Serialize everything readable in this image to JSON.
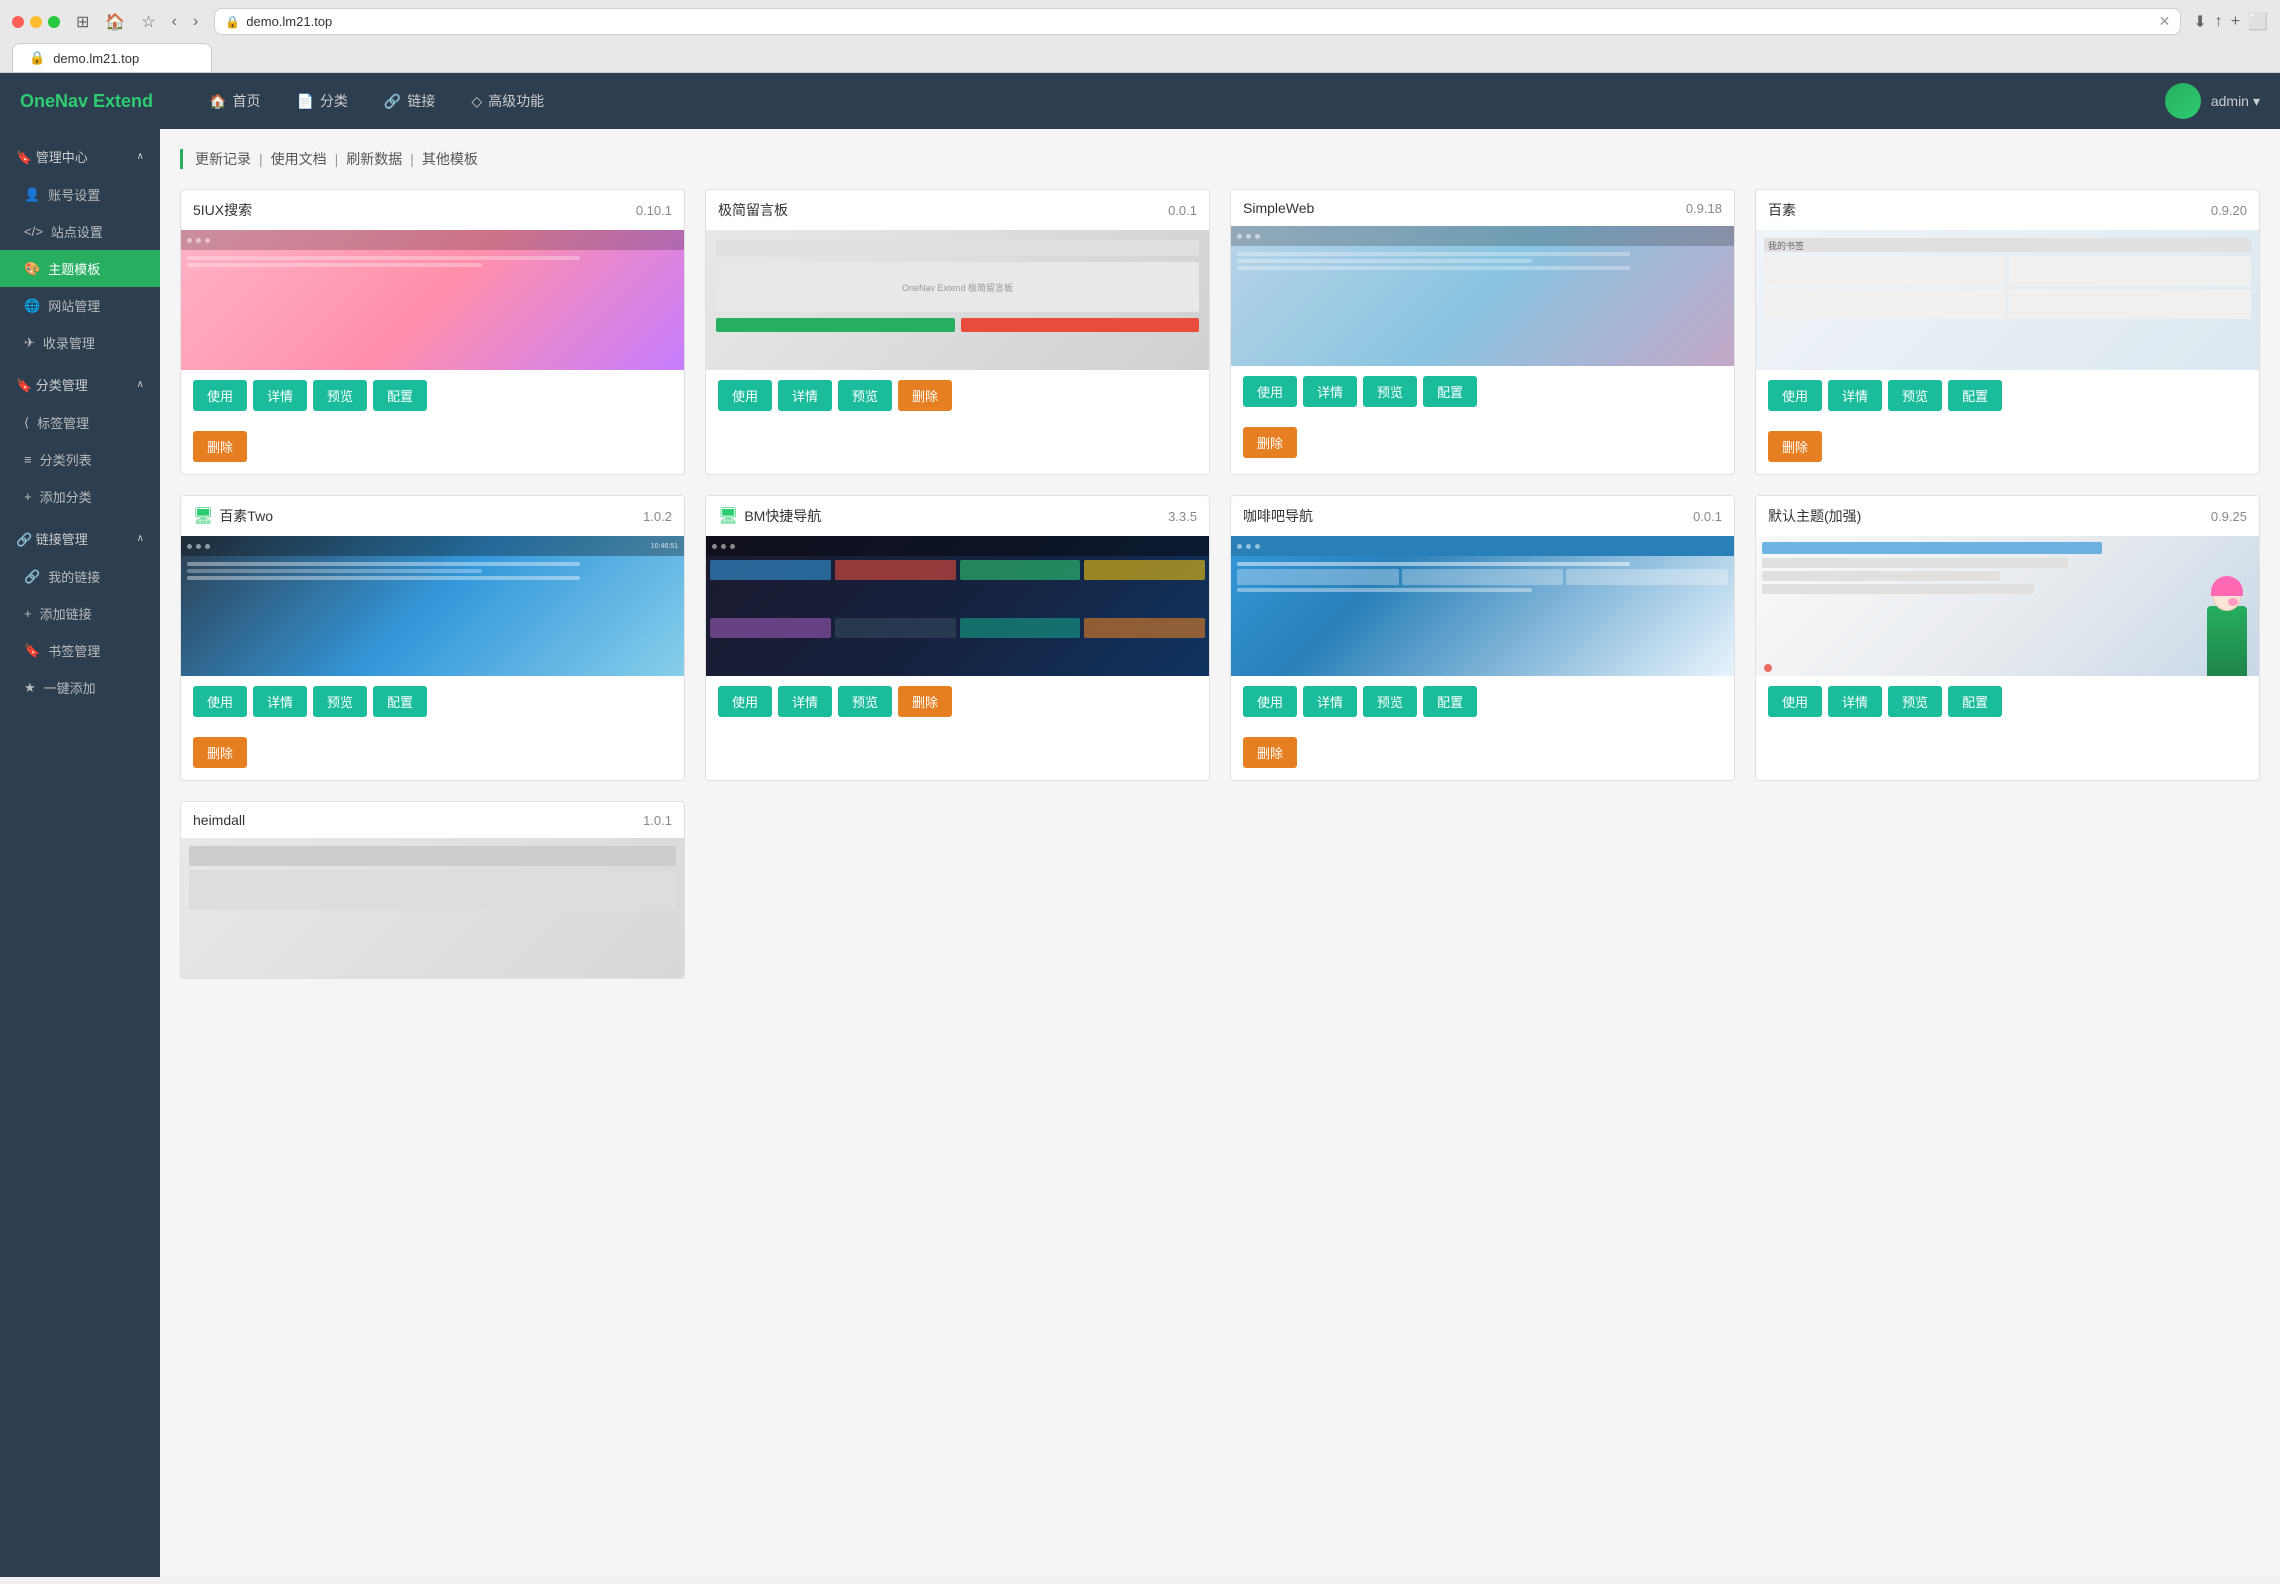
{
  "browser": {
    "url": "demo.lm21.top",
    "tab_label": "demo.lm21.top"
  },
  "app": {
    "brand": "OneNav Extend",
    "nav_items": [
      {
        "id": "home",
        "label": "首页",
        "icon": "🏠"
      },
      {
        "id": "category",
        "label": "分类",
        "icon": "📄"
      },
      {
        "id": "links",
        "label": "链接",
        "icon": "🔗"
      },
      {
        "id": "advanced",
        "label": "高级功能",
        "icon": "◇"
      }
    ],
    "admin_label": "admin",
    "admin_chevron": "▾"
  },
  "sidebar": {
    "groups": [
      {
        "id": "management",
        "label": "管理中心",
        "icon": "🔖",
        "expanded": true,
        "items": [
          {
            "id": "account",
            "label": "账号设置",
            "icon": "👤"
          },
          {
            "id": "site",
            "label": "站点设置",
            "icon": "</>"
          },
          {
            "id": "theme",
            "label": "主题模板",
            "icon": "🎨",
            "active": true
          },
          {
            "id": "website",
            "label": "网站管理",
            "icon": "🌐"
          },
          {
            "id": "collection",
            "label": "收录管理",
            "icon": "✈"
          }
        ]
      },
      {
        "id": "category",
        "label": "分类管理",
        "icon": "🔖",
        "expanded": true,
        "items": [
          {
            "id": "tag",
            "label": "标签管理",
            "icon": "⟨"
          },
          {
            "id": "catlist",
            "label": "分类列表",
            "icon": "≡"
          },
          {
            "id": "addcat",
            "label": "添加分类",
            "icon": "+"
          }
        ]
      },
      {
        "id": "links",
        "label": "链接管理",
        "icon": "🔗",
        "expanded": true,
        "items": [
          {
            "id": "mylinks",
            "label": "我的链接",
            "icon": "🔗"
          },
          {
            "id": "addlink",
            "label": "添加链接",
            "icon": "+"
          },
          {
            "id": "bookmarks",
            "label": "书签管理",
            "icon": "🔖"
          },
          {
            "id": "quickadd",
            "label": "一键添加",
            "icon": "★"
          }
        ]
      }
    ]
  },
  "breadcrumb": {
    "items": [
      "更新记录",
      "使用文档",
      "刷新数据",
      "其他模板"
    ],
    "separator": "|"
  },
  "themes": [
    {
      "id": "5iux",
      "name": "5IUX搜索",
      "version": "0.10.1",
      "preview_class": "preview-1",
      "actions": [
        "使用",
        "详情",
        "预览",
        "配置"
      ],
      "delete_active": false,
      "has_delete": true,
      "badge": ""
    },
    {
      "id": "jijian",
      "name": "极简留言板",
      "version": "0.0.1",
      "preview_class": "preview-2",
      "actions": [
        "使用",
        "详情",
        "预览",
        "删除"
      ],
      "delete_active": true,
      "has_delete": false,
      "badge": ""
    },
    {
      "id": "simpleweb",
      "name": "SimpleWeb",
      "version": "0.9.18",
      "preview_class": "preview-3",
      "actions": [
        "使用",
        "详情",
        "预览",
        "配置"
      ],
      "delete_active": false,
      "has_delete": true,
      "badge": ""
    },
    {
      "id": "baisu",
      "name": "百素",
      "version": "0.9.20",
      "preview_class": "preview-4",
      "actions": [
        "使用",
        "详情",
        "预览",
        "配置"
      ],
      "delete_active": false,
      "has_delete": true,
      "badge": ""
    },
    {
      "id": "baisutwo",
      "name": "百素Two",
      "version": "1.0.2",
      "preview_class": "preview-5",
      "actions": [
        "使用",
        "详情",
        "预览",
        "配置"
      ],
      "delete_active": false,
      "has_delete": true,
      "badge": "monitor",
      "badge_color": "#2ecc71"
    },
    {
      "id": "bm",
      "name": "BM快捷导航",
      "version": "3.3.5",
      "preview_class": "preview-6",
      "actions": [
        "使用",
        "详情",
        "预览",
        "删除"
      ],
      "delete_active": true,
      "has_delete": false,
      "badge": "monitor",
      "badge_color": "#2ecc71"
    },
    {
      "id": "coffee",
      "name": "咖啡吧导航",
      "version": "0.0.1",
      "preview_class": "preview-7",
      "actions": [
        "使用",
        "详情",
        "预览",
        "配置"
      ],
      "delete_active": false,
      "has_delete": true,
      "badge": ""
    },
    {
      "id": "default",
      "name": "默认主题(加强)",
      "version": "0.9.25",
      "preview_class": "preview-8",
      "actions": [
        "使用",
        "详情",
        "预览",
        "配置"
      ],
      "delete_active": false,
      "has_delete": false,
      "badge": ""
    }
  ],
  "heimdall": {
    "name": "heimdall",
    "version": "1.0.1"
  },
  "buttons": {
    "use": "使用",
    "detail": "详情",
    "preview": "预览",
    "config": "配置",
    "delete": "删除",
    "delete_btn": "删除"
  }
}
